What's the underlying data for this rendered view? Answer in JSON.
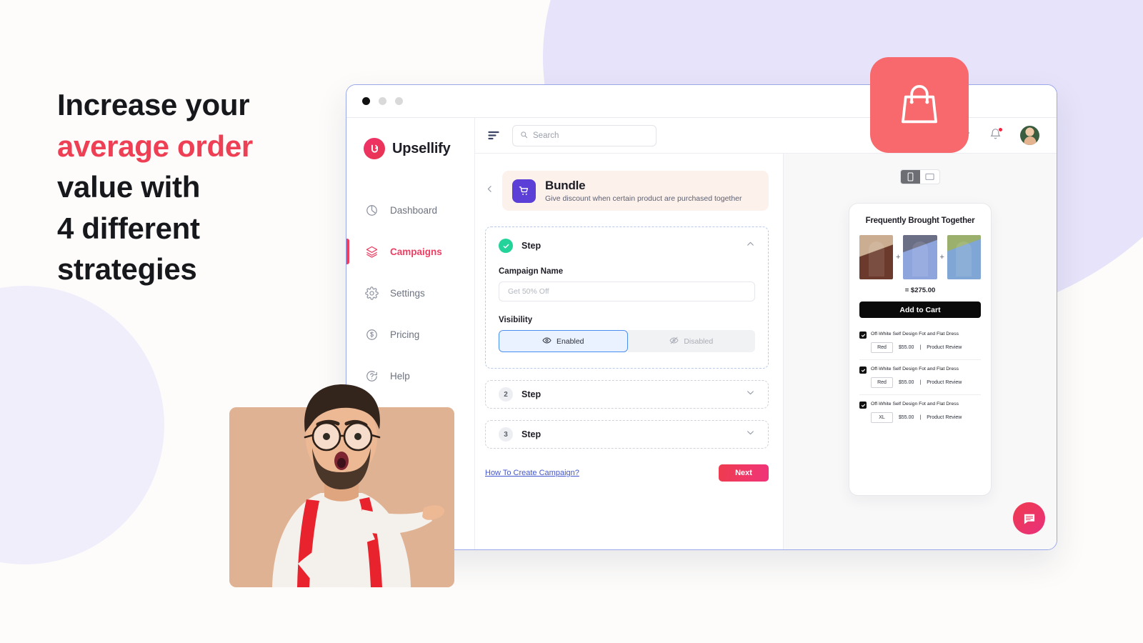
{
  "headline": {
    "line1": "Increase your",
    "line2_accent": "average order",
    "line3": "value with",
    "line4": "4 different",
    "line5": "strategies"
  },
  "colors": {
    "accent_pink": "#ee3f54",
    "brand_pink": "#ee3f63",
    "purple": "#5b3fd6",
    "green": "#23d39a",
    "blue": "#4a8ff0",
    "coral": "#f8696d",
    "background": "#fdfcfa",
    "lavender": "#e6e3fa"
  },
  "window": {
    "dots": [
      "window-dot-close",
      "window-dot-minimize",
      "window-dot-maximize"
    ]
  },
  "sidebar": {
    "brand": {
      "logo_letter": "U",
      "name": "Upsellify"
    },
    "items": [
      {
        "label": "Dashboard",
        "icon": "pie-chart-icon",
        "active": false
      },
      {
        "label": "Campaigns",
        "icon": "layers-icon",
        "active": true
      },
      {
        "label": "Settings",
        "icon": "gear-icon",
        "active": false
      },
      {
        "label": "Pricing",
        "icon": "dollar-circle-icon",
        "active": false
      },
      {
        "label": "Help",
        "icon": "question-circle-icon",
        "active": false
      }
    ]
  },
  "topbar": {
    "filter_icon": "filter-lines-icon",
    "search": {
      "placeholder": "Search",
      "icon": "search-icon"
    },
    "star_icon": "star-icon",
    "bell_icon": "bell-icon",
    "bell_has_badge": true,
    "avatar": "user-avatar"
  },
  "bundle": {
    "back_icon": "chevron-left-icon",
    "icon": "shopping-cart-icon",
    "title": "Bundle",
    "subtitle": "Give discount when certain product are purchased together"
  },
  "steps": [
    {
      "marker": "check",
      "label": "Step",
      "caret": "chevron-up-icon",
      "expanded": true,
      "fields": {
        "campaign_name_label": "Campaign Name",
        "campaign_name_placeholder": "Get 50% Off",
        "visibility_label": "Visibility",
        "visibility_options": [
          {
            "label": "Enabled",
            "icon": "eye-icon",
            "selected": true
          },
          {
            "label": "Disabled",
            "icon": "eye-off-icon",
            "selected": false
          }
        ]
      }
    },
    {
      "marker": "2",
      "label": "Step",
      "caret": "chevron-down-icon",
      "expanded": false
    },
    {
      "marker": "3",
      "label": "Step",
      "caret": "chevron-down-icon",
      "expanded": false
    }
  ],
  "form_footer": {
    "help_link": "How To Create Campaign?",
    "next_button": "Next"
  },
  "preview": {
    "device_toggle": [
      {
        "icon": "mobile-icon",
        "selected": true
      },
      {
        "icon": "desktop-icon",
        "selected": false
      }
    ],
    "widget": {
      "title": "Frequently Brought Together",
      "plus_symbol": "+",
      "total": "= $275.00",
      "add_to_cart": "Add to Cart",
      "products": [
        {
          "name": "Off-White Self Design Fot and Flat Dress",
          "variant": "Red",
          "price": "$55.00",
          "separator": "|",
          "review": "Product Review",
          "checked": true
        },
        {
          "name": "Off-White Self Design Fot and Flat Dress",
          "variant": "Red",
          "price": "$55.00",
          "separator": "|",
          "review": "Product Review",
          "checked": true
        },
        {
          "name": "Off-White Self Design Fot and Flat Dress",
          "variant": "XL",
          "price": "$55.00",
          "separator": "|",
          "review": "Product Review",
          "checked": true
        }
      ]
    }
  },
  "floating": {
    "app_badge_icon": "shopping-bag-icon",
    "chat_fab_icon": "chat-bubble-icon"
  },
  "person": {
    "alt": "surprised-man-pointing-right"
  }
}
